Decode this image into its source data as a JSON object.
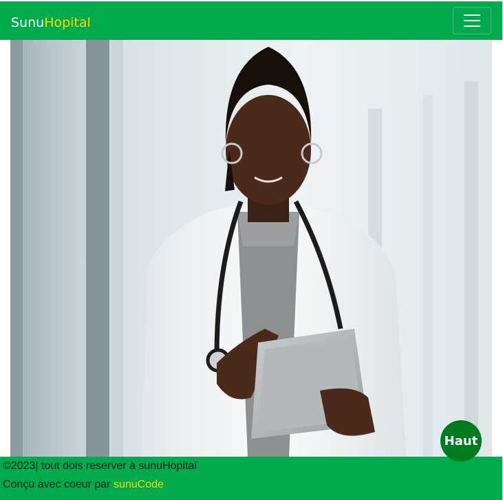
{
  "header": {
    "brand_prefix": "Sunu",
    "brand_suffix": "Hopital",
    "menu_icon": "hamburger-icon"
  },
  "hero": {
    "image": "doctor-with-tablet-photo"
  },
  "footer": {
    "copyright": "©2023| tout dois reserver à sunuHopital",
    "made_with_prefix": "Conçu avec coeur par ",
    "author_link": "sunuCode"
  },
  "back_to_top": {
    "label": "Haut"
  },
  "colors": {
    "primary": "#00aa4d",
    "accent": "#ffd700",
    "back_to_top_bg": "#007a1f"
  }
}
